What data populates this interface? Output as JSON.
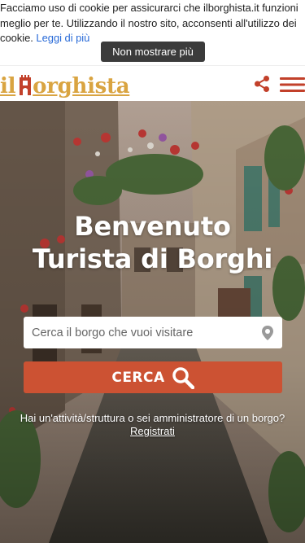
{
  "cookie_banner": {
    "text": "Facciamo uso di cookie per assicurarci che ilborghista.it funzioni meglio per te. Utilizzando il nostro sito, acconsenti all'utilizzo dei cookie.",
    "link_label": "Leggi di più",
    "dismiss_label": "Non mostrare più"
  },
  "header": {
    "logo_prefix": "il",
    "logo_suffix": "orghista",
    "logo_color": "#d9a441",
    "share_icon": "share-icon",
    "menu_icon": "hamburger-menu-icon",
    "icon_color": "#c2402a"
  },
  "hero": {
    "title_line1": "Benvenuto",
    "title_line2": "Turista di Borghi",
    "search": {
      "placeholder": "Cerca il borgo che vuoi visitare",
      "value": "",
      "icon": "location-pin-icon"
    },
    "search_button": {
      "label": "CERCA",
      "icon": "search-icon",
      "color": "#cc5233"
    },
    "business_prompt": "Hai un'attività/struttura o sei amministratore di un borgo?",
    "register_label": "Registrati"
  }
}
